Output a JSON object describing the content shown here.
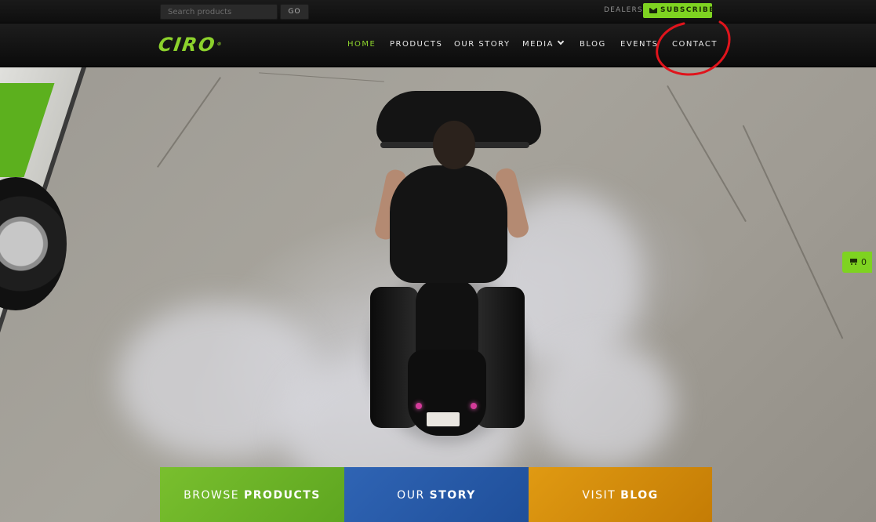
{
  "topbar": {
    "search_placeholder": "Search products",
    "go_label": "GO",
    "dealers_label": "DEALERS",
    "subscribe_label": "SUBSCRIBE"
  },
  "navbar": {
    "logo_text": "CIRO",
    "logo_mark": "®",
    "items": [
      {
        "label": "HOME",
        "active": true
      },
      {
        "label": "PRODUCTS"
      },
      {
        "label": "OUR STORY"
      },
      {
        "label": "MEDIA",
        "has_dropdown": true
      },
      {
        "label": "BLOG"
      },
      {
        "label": "EVENTS"
      },
      {
        "label": "CONTACT"
      }
    ]
  },
  "cart": {
    "count": "0"
  },
  "tiles": [
    {
      "lead": "BROWSE ",
      "strong": "PRODUCTS",
      "color": "#6cb427"
    },
    {
      "lead": "OUR ",
      "strong": "STORY",
      "color": "#2a5cab"
    },
    {
      "lead": "VISIT ",
      "strong": "BLOG",
      "color": "#d68c0c"
    }
  ],
  "colors": {
    "accent_green": "#7ed321",
    "annotation_red": "#e0141c"
  }
}
